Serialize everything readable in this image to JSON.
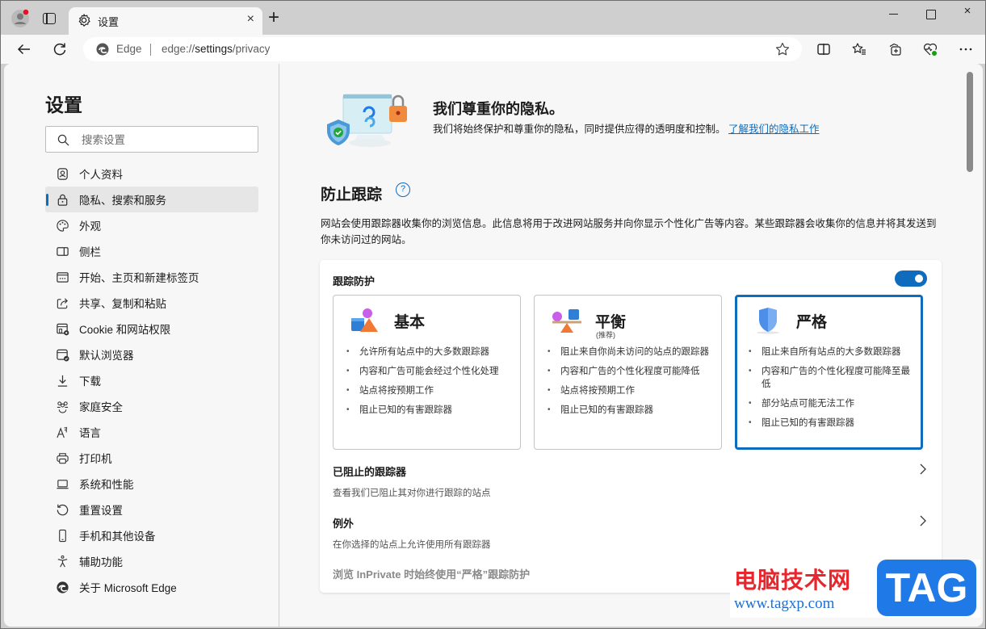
{
  "browser": {
    "tab": {
      "title": "设置",
      "icon": "gear-icon"
    },
    "new_tab_label": "+",
    "window_controls": {
      "minimize": "minimize",
      "maximize": "maximize",
      "close": "×"
    },
    "address": {
      "site_label": "Edge",
      "url_prefix": "edge://",
      "url_host": "settings",
      "url_path": "/privacy"
    },
    "toolbar_icons": [
      "split-screen-icon",
      "favorites-icon",
      "collections-icon",
      "browser-essentials-icon",
      "more-icon"
    ]
  },
  "sidebar": {
    "title": "设置",
    "search_placeholder": "搜索设置",
    "items": [
      {
        "label": "个人资料",
        "icon": "profile-icon",
        "active": false
      },
      {
        "label": "隐私、搜索和服务",
        "icon": "lock-icon",
        "active": true
      },
      {
        "label": "外观",
        "icon": "palette-icon",
        "active": false
      },
      {
        "label": "侧栏",
        "icon": "sidebar-icon",
        "active": false
      },
      {
        "label": "开始、主页和新建标签页",
        "icon": "home-tabs-icon",
        "active": false
      },
      {
        "label": "共享、复制和粘贴",
        "icon": "share-icon",
        "active": false
      },
      {
        "label": "Cookie 和网站权限",
        "icon": "cookie-site-permissions-icon",
        "active": false
      },
      {
        "label": "默认浏览器",
        "icon": "default-browser-icon",
        "active": false
      },
      {
        "label": "下载",
        "icon": "download-icon",
        "active": false
      },
      {
        "label": "家庭安全",
        "icon": "family-icon",
        "active": false
      },
      {
        "label": "语言",
        "icon": "language-icon",
        "active": false
      },
      {
        "label": "打印机",
        "icon": "printer-icon",
        "active": false
      },
      {
        "label": "系统和性能",
        "icon": "laptop-icon",
        "active": false
      },
      {
        "label": "重置设置",
        "icon": "reset-icon",
        "active": false
      },
      {
        "label": "手机和其他设备",
        "icon": "phone-icon",
        "active": false
      },
      {
        "label": "辅助功能",
        "icon": "accessibility-icon",
        "active": false
      },
      {
        "label": "关于 Microsoft Edge",
        "icon": "edge-logo-icon",
        "active": false
      }
    ]
  },
  "main": {
    "hero": {
      "title": "我们尊重你的隐私。",
      "description": "我们将始终保护和尊重你的隐私，同时提供应得的透明度和控制。",
      "link": "了解我们的隐私工作"
    },
    "section": {
      "title": "防止跟踪",
      "description": "网站会使用跟踪器收集你的浏览信息。此信息将用于改进网站服务并向你显示个性化广告等内容。某些跟踪器会收集你的信息并将其发送到你未访问过的网站。"
    },
    "tracking": {
      "label": "跟踪防护",
      "enabled": true,
      "options": [
        {
          "name": "基本",
          "subtitle": "",
          "selected": false,
          "icon": "shapes-icon",
          "bullets": [
            "允许所有站点中的大多数跟踪器",
            "内容和广告可能会经过个性化处理",
            "站点将按预期工作",
            "阻止已知的有害跟踪器"
          ]
        },
        {
          "name": "平衡",
          "subtitle": "(推荐)",
          "selected": false,
          "icon": "balance-icon",
          "bullets": [
            "阻止来自你尚未访问的站点的跟踪器",
            "内容和广告的个性化程度可能降低",
            "站点将按预期工作",
            "阻止已知的有害跟踪器"
          ]
        },
        {
          "name": "严格",
          "subtitle": "",
          "selected": true,
          "icon": "shield-icon",
          "bullets": [
            "阻止来自所有站点的大多数跟踪器",
            "内容和广告的个性化程度可能降至最低",
            "部分站点可能无法工作",
            "阻止已知的有害跟踪器"
          ]
        }
      ],
      "rows": [
        {
          "title": "已阻止的跟踪器",
          "description": "查看我们已阻止其对你进行跟踪的站点"
        },
        {
          "title": "例外",
          "description": "在你选择的站点上允许使用所有跟踪器"
        }
      ],
      "inprivate_label": "浏览 InPrivate 时始终使用“严格”跟踪防护"
    }
  },
  "watermark": {
    "cn_text": "电脑技术网",
    "url": "www.tagxp.com",
    "badge": "TAG"
  },
  "colors": {
    "accent": "#0f6cbd",
    "watermark_red": "#e8262d",
    "watermark_blue": "#1f7ae8"
  }
}
